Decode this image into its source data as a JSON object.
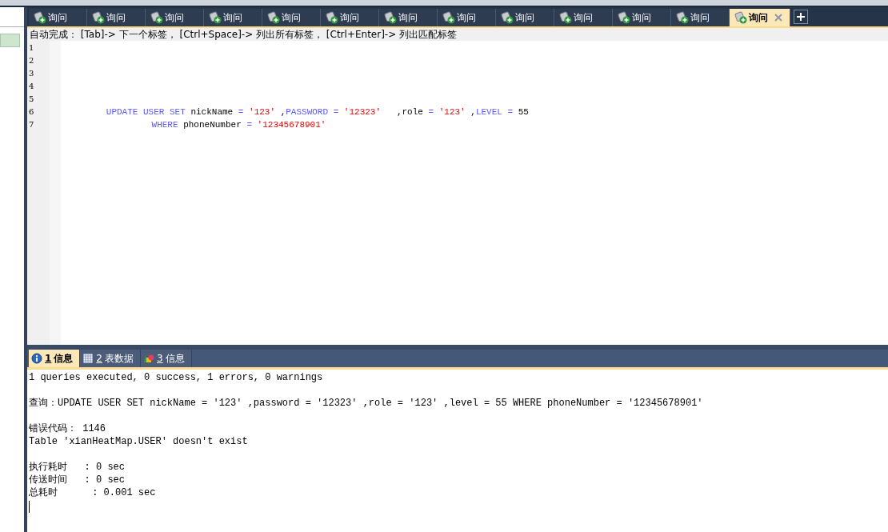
{
  "tabs": [
    {
      "label": "询问",
      "selected": false
    },
    {
      "label": "询问",
      "selected": false
    },
    {
      "label": "询问",
      "selected": false
    },
    {
      "label": "询问",
      "selected": false
    },
    {
      "label": "询问",
      "selected": false
    },
    {
      "label": "询问",
      "selected": false
    },
    {
      "label": "询问",
      "selected": false
    },
    {
      "label": "询问",
      "selected": false
    },
    {
      "label": "询问",
      "selected": false
    },
    {
      "label": "询问",
      "selected": false
    },
    {
      "label": "询问",
      "selected": false
    },
    {
      "label": "询问",
      "selected": false
    },
    {
      "label": "询问",
      "selected": true
    }
  ],
  "autocomplete_hint": "自动完成： [Tab]-> 下一个标签， [Ctrl+Space]-> 列出所有标签， [Ctrl+Enter]-> 列出匹配标签",
  "editor": {
    "lines": [
      {
        "number": "1"
      },
      {
        "number": "2"
      },
      {
        "number": "3"
      },
      {
        "number": "4"
      },
      {
        "number": "5"
      },
      {
        "number": "6",
        "tokens": [
          {
            "kind": "keyword",
            "text": "\tUPDATE USER SET"
          },
          {
            "kind": "plain",
            "text": " nickName "
          },
          {
            "kind": "keyword",
            "text": "="
          },
          {
            "kind": "string",
            "text": " '123'"
          },
          {
            "kind": "plain",
            "text": " ,"
          },
          {
            "kind": "keyword",
            "text": "PASSWORD ="
          },
          {
            "kind": "string",
            "text": " '12323'"
          },
          {
            "kind": "plain",
            "text": "   ,role "
          },
          {
            "kind": "keyword",
            "text": "="
          },
          {
            "kind": "string",
            "text": " '123'"
          },
          {
            "kind": "plain",
            "text": " ,"
          },
          {
            "kind": "keyword",
            "text": "LEVEL ="
          },
          {
            "kind": "plain",
            "text": " 55"
          }
        ]
      },
      {
        "number": "7",
        "tokens": [
          {
            "kind": "keyword",
            "text": "\t\tWHERE"
          },
          {
            "kind": "plain",
            "text": " phoneNumber "
          },
          {
            "kind": "keyword",
            "text": "="
          },
          {
            "kind": "string",
            "text": " '12345678901'"
          }
        ]
      }
    ]
  },
  "result_tabs": [
    {
      "number": "1",
      "label": "信息",
      "kind": "info",
      "selected": true
    },
    {
      "number": "2",
      "label": "表数据",
      "kind": "table",
      "selected": false
    },
    {
      "number": "3",
      "label": "信息",
      "kind": "shapes",
      "selected": false
    }
  ],
  "output": {
    "blocks": [
      [
        "1 queries executed, 0 success, 1 errors, 0 warnings"
      ],
      [
        "查询：UPDATE USER SET nickName = '123' ,password = '12323' ,role = '123' ,level = 55 WHERE phoneNumber = '12345678901'"
      ],
      [
        "错误代码： 1146",
        "Table 'xianHeatMap.USER' doesn't exist"
      ],
      [
        "执行耗时   : 0 sec",
        "传送时间   : 0 sec",
        "总耗时      : 0.001 sec"
      ]
    ]
  }
}
